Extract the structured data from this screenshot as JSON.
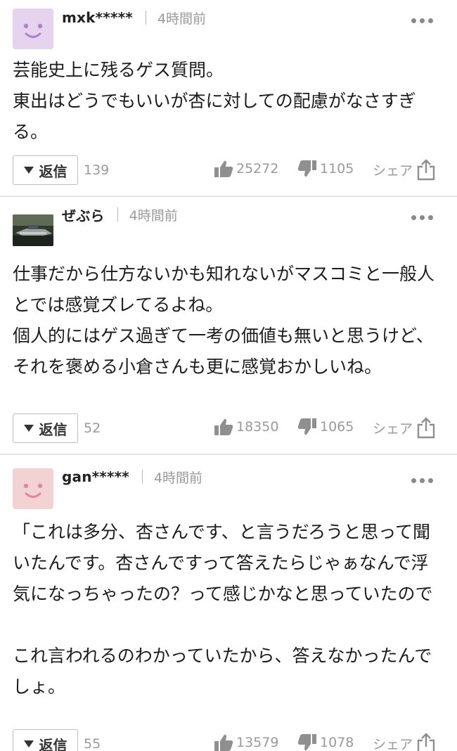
{
  "comments": [
    {
      "username": "mxk*****",
      "time": "4時間前",
      "avatar": "smiley-avatar-purple",
      "avatar_bg": "#e6d3ee",
      "avatar_fg": "#b27fd0",
      "text": "芸能史上に残るゲス質問。\n東出はどうでもいいが杏に対しての配慮がなさすぎる。",
      "reply_label": "返信",
      "reply_count": "139",
      "likes": "25272",
      "dislikes": "1105",
      "share_label": "シェア"
    },
    {
      "username": "ぜぶら",
      "time": "4時間前",
      "avatar": "photo-avatar",
      "text": "仕事だから仕方ないかも知れないがマスコミと一般人とでは感覚ズレてるよね。\n個人的にはゲス過ぎて一考の価値も無いと思うけど、それを褒める小倉さんも更に感覚おかしいね。",
      "reply_label": "返信",
      "reply_count": "52",
      "likes": "18350",
      "dislikes": "1065",
      "share_label": "シェア"
    },
    {
      "username": "gan*****",
      "time": "4時間前",
      "avatar": "smiley-avatar-pink",
      "avatar_bg": "#f3d2d4",
      "avatar_fg": "#e08a95",
      "text": "「これは多分、杏さんです、と言うだろうと思って聞いたんです。杏さんですって答えたらじゃぁなんで浮気になっちゃったの？って感じかなと思っていたので\n\nこれ言われるのわかっていたから、答えなかったんでしょ。",
      "reply_label": "返信",
      "reply_count": "55",
      "likes": "13579",
      "dislikes": "1078",
      "share_label": "シェア"
    }
  ],
  "colors": {
    "text": "#1c1c1c",
    "muted": "#9a9a9a",
    "divider": "#e4e4e4"
  }
}
